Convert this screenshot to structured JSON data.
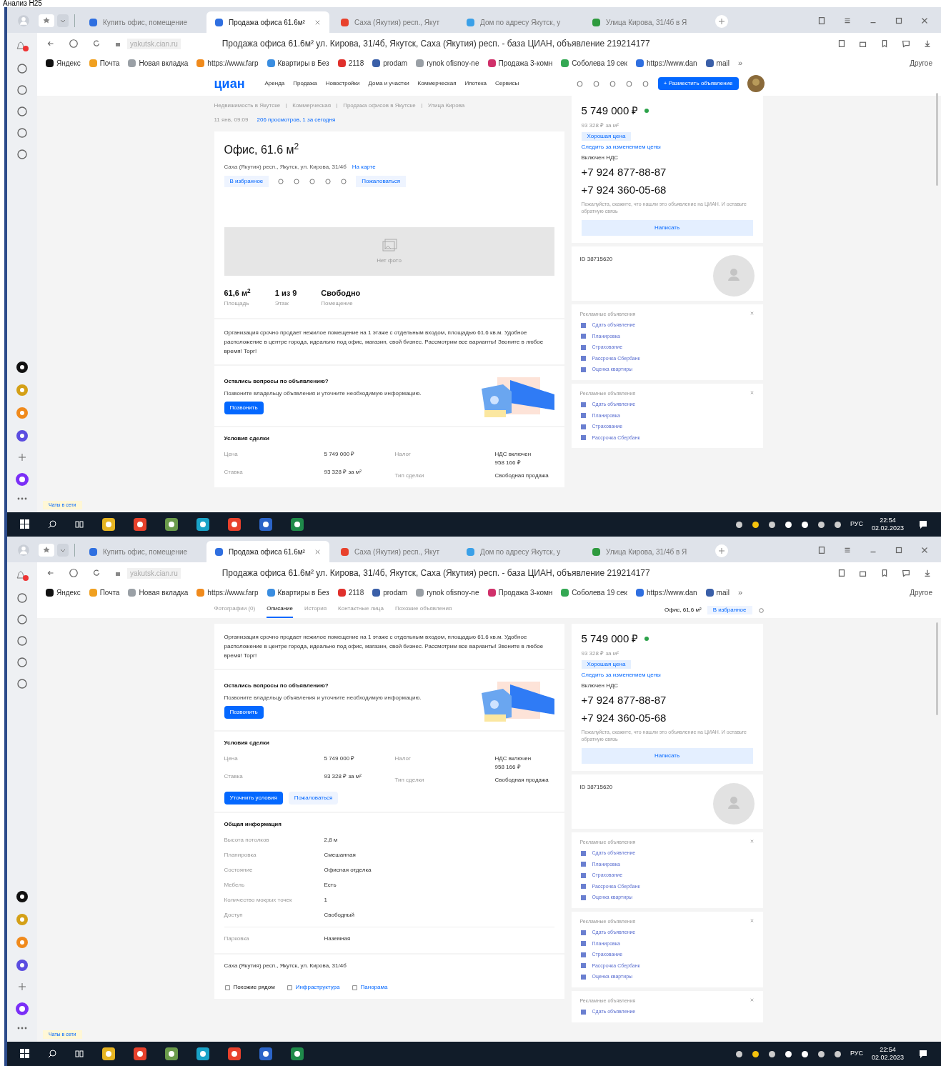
{
  "caption": "Анализ Н25",
  "screens": [
    {
      "browser": {
        "tabs": [
          {
            "title": "Купить офис, помещение",
            "selected": false,
            "color": "#2f6fe0"
          },
          {
            "title": "Продажа офиса 61.6м²",
            "selected": true,
            "color": "#2f6fe0"
          },
          {
            "title": "Саха (Якутия) респ., Якут",
            "selected": false,
            "color": "#e8412c"
          },
          {
            "title": "Дом по адресу Якутск, у",
            "selected": false,
            "color": "#3aa0e8"
          },
          {
            "title": "Улица Кирова, 31/4б в Я",
            "selected": false,
            "color": "#2e9a3e"
          }
        ],
        "url": "yakutsk.cian.ru",
        "page_title": "Продажа офиса 61.6м² ул. Кирова, 31/4б, Якутск, Саха (Якутия) респ. - база ЦИАН, объявление 219214177",
        "bookmarks": [
          {
            "label": "Яндекс",
            "color": "#111111"
          },
          {
            "label": "Почта",
            "color": "#f0a020"
          },
          {
            "label": "Новая вкладка",
            "color": "#9aa0a6"
          },
          {
            "label": "https://www.farp",
            "color": "#f08a1c"
          },
          {
            "label": "Квартиры в Без",
            "color": "#3a8de0"
          },
          {
            "label": "2118",
            "color": "#e0302c"
          },
          {
            "label": "prodam",
            "color": "#3a5fa8"
          },
          {
            "label": "rynok ofisnoy-ne",
            "color": "#9aa0a6"
          },
          {
            "label": "Продажа 3-комн",
            "color": "#d0306a"
          },
          {
            "label": "Соболева 19 сек",
            "color": "#34a853"
          },
          {
            "label": "https://www.dan",
            "color": "#2f6fe0"
          },
          {
            "label": "mail",
            "color": "#3a5fa8"
          }
        ],
        "more": "»",
        "other": "Другое"
      },
      "header": {
        "logo": "циан",
        "nav": [
          "Аренда",
          "Продажа",
          "Новостройки",
          "Дома и участки",
          "Коммерческая",
          "Ипотека",
          "Сервисы"
        ],
        "post_button": "+ Разместить объявление"
      },
      "main": [
        {
          "kind": "breadcrumbs",
          "items": [
            "Недвижимость в Якутске",
            "Коммерческая",
            "Продажа офисов в Якутске",
            "Улица Кирова"
          ],
          "date": "11 янв, 09:09",
          "views": "206 просмотров, 1 за сегодня"
        },
        {
          "kind": "summary",
          "title": "Офис, 61.6 м$^{2}$",
          "address": "Саха (Якутия) респ., Якутск, ул. Кирова, 31/4б",
          "map_link": "На карте",
          "favorite": "В избранное",
          "complain": "Пожаловаться",
          "photo_label": "Нет фото",
          "facts": [
            {
              "value": "61,6 м$^{2}$",
              "label": "Площадь"
            },
            {
              "value": "1 из 9",
              "label": "Этаж"
            },
            {
              "value": "Свободно",
              "label": "Помещение"
            }
          ]
        },
        {
          "kind": "description",
          "text": "Организация срочно продает нежилое помещение на 1 этаже с отдельным входом, площадью 61.6 кв.м. Удобное расположение в центре города, идеально под офис, магазин, свой бизнес. Рассмотрим все варианты! Звоните в любое время! Торг!"
        },
        {
          "kind": "question",
          "title": "Остались вопросы по объявлению?",
          "text": "Позвоните владельцу объявления и уточните необходимую информацию.",
          "button": "Позвонить"
        },
        {
          "kind": "conditions",
          "title": "Условия сделки",
          "left": [
            {
              "label": "Цена",
              "value": "5 749 000 ₽"
            },
            {
              "label": "Ставка",
              "value": "93 328 ₽ за м²"
            }
          ],
          "right": [
            {
              "label": "Налог",
              "value": "НДС включен",
              "extra": "958 166 ₽"
            },
            {
              "label": "Тип сделки",
              "value": "Свободная продажа"
            }
          ]
        }
      ],
      "side": [
        {
          "kind": "price",
          "price": "5 749 000 ₽",
          "per_m": "93 328 ₽ за м²",
          "tag": "Хорошая цена",
          "watch": "Следить за изменением цены",
          "vat": "Включен НДС",
          "phones": [
            "+7 924 877-88-87",
            "+7 924 360-05-68"
          ],
          "note": "Пожалуйста, скажите, что нашли это объявление на ЦИАН. И оставьте обратную связь",
          "button": "Написать"
        },
        {
          "kind": "agent",
          "id": "ID 38715620"
        },
        {
          "kind": "ads",
          "title": "Рекламные объявления",
          "items": [
            "Сдать объявление",
            "Планировка",
            "Страхование",
            "Рассрочка Сбербанк",
            "Оценка квартиры"
          ]
        },
        {
          "kind": "ads",
          "title": "Рекламные объявления",
          "items": [
            "Сдать объявление",
            "Планировка",
            "Страхование",
            "Рассрочка Сбербанк"
          ]
        }
      ],
      "chat": "Чаты в сети",
      "taskbar": {
        "lang": "РУС",
        "time": "22:54",
        "date": "02.02.2023"
      }
    },
    {
      "browser": {
        "tabs": [
          {
            "title": "Купить офис, помещение",
            "selected": false,
            "color": "#2f6fe0"
          },
          {
            "title": "Продажа офиса 61.6м²",
            "selected": true,
            "color": "#2f6fe0"
          },
          {
            "title": "Саха (Якутия) респ., Якут",
            "selected": false,
            "color": "#e8412c"
          },
          {
            "title": "Дом по адресу Якутск, у",
            "selected": false,
            "color": "#3aa0e8"
          },
          {
            "title": "Улица Кирова, 31/4б в Я",
            "selected": false,
            "color": "#2e9a3e"
          }
        ],
        "url": "yakutsk.cian.ru",
        "page_title": "Продажа офиса 61.6м² ул. Кирова, 31/4б, Якутск, Саха (Якутия) респ. - база ЦИАН, объявление 219214177",
        "bookmarks": [
          {
            "label": "Яндекс",
            "color": "#111111"
          },
          {
            "label": "Почта",
            "color": "#f0a020"
          },
          {
            "label": "Новая вкладка",
            "color": "#9aa0a6"
          },
          {
            "label": "https://www.farp",
            "color": "#f08a1c"
          },
          {
            "label": "Квартиры в Без",
            "color": "#3a8de0"
          },
          {
            "label": "2118",
            "color": "#e0302c"
          },
          {
            "label": "prodam",
            "color": "#3a5fa8"
          },
          {
            "label": "rynok ofisnoy-ne",
            "color": "#9aa0a6"
          },
          {
            "label": "Продажа 3-комн",
            "color": "#d0306a"
          },
          {
            "label": "Соболева 19 сек",
            "color": "#34a853"
          },
          {
            "label": "https://www.dan",
            "color": "#2f6fe0"
          },
          {
            "label": "mail",
            "color": "#3a5fa8"
          }
        ],
        "more": "»",
        "other": "Другое"
      },
      "sticky": {
        "tabs": [
          {
            "label": "Фотографии (0)",
            "selected": false
          },
          {
            "label": "Описание",
            "selected": true
          },
          {
            "label": "История",
            "selected": false
          },
          {
            "label": "Контактные лица",
            "selected": false
          },
          {
            "label": "Похожие объявления",
            "selected": false
          }
        ],
        "title": "Офис, 61,6 м²",
        "favorite": "В избранное"
      },
      "main": [
        {
          "kind": "description",
          "text": "Организация срочно продает нежилое помещение на 1 этаже с отдельным входом, площадью 61.6 кв.м. Удобное расположение в центре города, идеально под офис, магазин, свой бизнес. Рассмотрим все варианты! Звоните в любое время! Торг!"
        },
        {
          "kind": "question",
          "title": "Остались вопросы по объявлению?",
          "text": "Позвоните владельцу объявления и уточните необходимую информацию.",
          "button": "Позвонить"
        },
        {
          "kind": "conditions",
          "title": "Условия сделки",
          "left": [
            {
              "label": "Цена",
              "value": "5 749 000 ₽"
            },
            {
              "label": "Ставка",
              "value": "93 328 ₽ за м²"
            }
          ],
          "right": [
            {
              "label": "Налог",
              "value": "НДС включен",
              "extra": "958 166 ₽"
            },
            {
              "label": "Тип сделки",
              "value": "Свободная продажа"
            }
          ],
          "buttons": [
            "Уточнить условия",
            "Пожаловаться"
          ]
        },
        {
          "kind": "general",
          "title": "Общая информация",
          "rows": [
            {
              "label": "Высота потолков",
              "value": "2,8 м"
            },
            {
              "label": "Планировка",
              "value": "Смешанная"
            },
            {
              "label": "Состояние",
              "value": "Офисная отделка"
            },
            {
              "label": "Мебель",
              "value": "Есть"
            },
            {
              "label": "Количество мокрых точек",
              "value": "1"
            },
            {
              "label": "Доступ",
              "value": "Свободный"
            }
          ],
          "extra": {
            "label": "Парковка",
            "value": "Наземная"
          }
        },
        {
          "kind": "address",
          "text": "Саха (Якутия) респ., Якутск, ул. Кирова, 31/4б",
          "links": [
            "Похожие рядом",
            "Инфраструктура",
            "Панорама"
          ]
        }
      ],
      "side": [
        {
          "kind": "price",
          "price": "5 749 000 ₽",
          "per_m": "93 328 ₽ за м²",
          "tag": "Хорошая цена",
          "watch": "Следить за изменением цены",
          "vat": "Включен НДС",
          "phones": [
            "+7 924 877-88-87",
            "+7 924 360-05-68"
          ],
          "note": "Пожалуйста, скажите, что нашли это объявление на ЦИАН. И оставьте обратную связь",
          "button": "Написать"
        },
        {
          "kind": "agent",
          "id": "ID 38715620"
        },
        {
          "kind": "ads",
          "title": "Рекламные объявления",
          "items": [
            "Сдать объявление",
            "Планировка",
            "Страхование",
            "Рассрочка Сбербанк",
            "Оценка квартиры"
          ]
        },
        {
          "kind": "ads",
          "title": "Рекламные объявления",
          "items": [
            "Сдать объявление",
            "Планировка",
            "Страхование",
            "Рассрочка Сбербанк",
            "Оценка квартиры"
          ]
        },
        {
          "kind": "ads",
          "title": "Рекламные объявления",
          "items": [
            "Сдать объявление"
          ]
        }
      ],
      "chat": "Чаты в сети",
      "taskbar": {
        "lang": "РУС",
        "time": "22:54",
        "date": "02.02.2023"
      }
    }
  ]
}
